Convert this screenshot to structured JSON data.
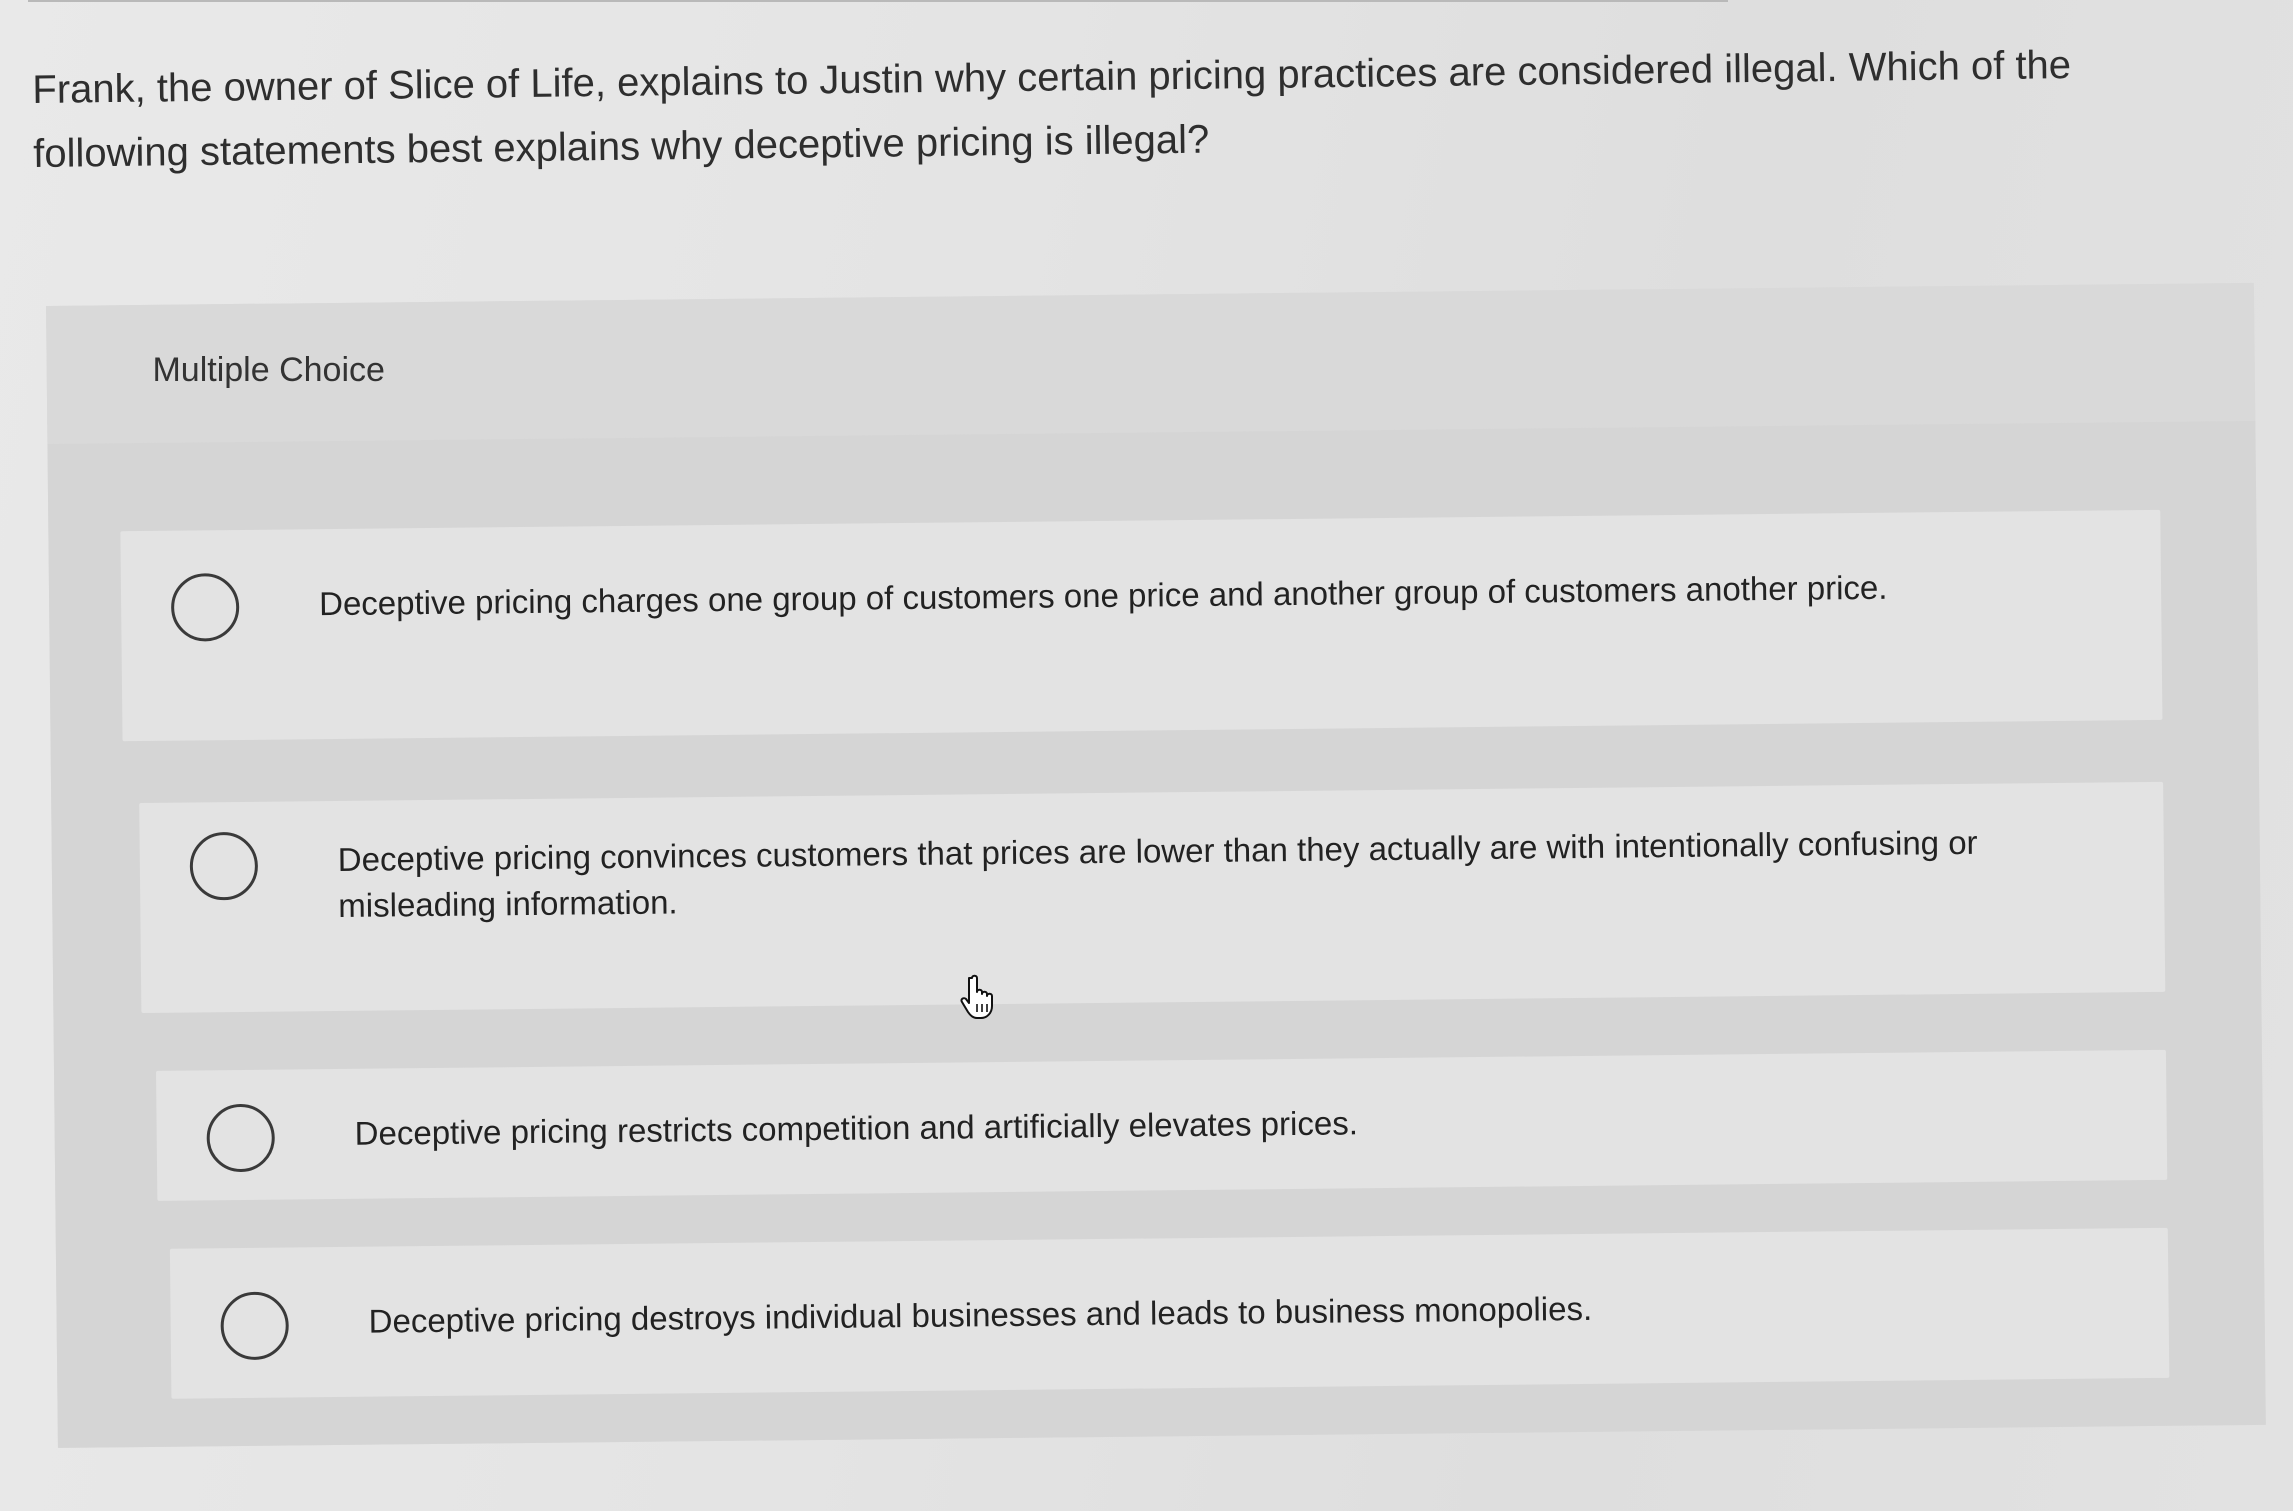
{
  "question": {
    "text": "Frank, the owner of Slice of Life, explains to Justin why certain pricing practices are considered illegal. Which of the following statements best explains why deceptive pricing is illegal?"
  },
  "multiple_choice": {
    "label": "Multiple Choice",
    "options": [
      {
        "text": "Deceptive pricing charges one group of customers one price and another group of customers another price."
      },
      {
        "text": "Deceptive pricing convinces customers that prices are lower than they actually are with intentionally confusing or misleading information."
      },
      {
        "text": "Deceptive pricing restricts competition and artificially elevates prices."
      },
      {
        "text": "Deceptive pricing destroys individual businesses and leads to business monopolies."
      }
    ]
  },
  "icons": {
    "radio": "radio-unchecked-icon",
    "cursor": "hand-pointer-icon"
  }
}
